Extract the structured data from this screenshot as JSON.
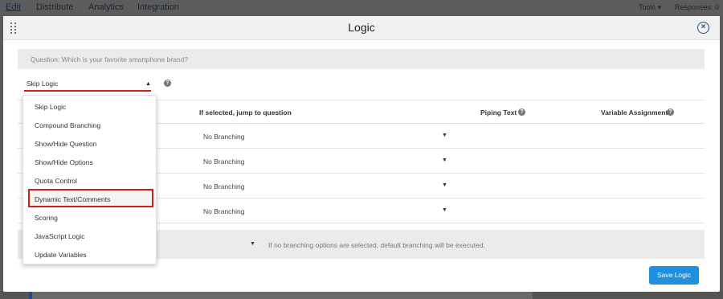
{
  "topnav": {
    "items": [
      "Edit",
      "Distribute",
      "Analytics",
      "Integration"
    ],
    "tools_label": "Tools ▾",
    "responses_label": "Responses: 0"
  },
  "modal": {
    "title": "Logic",
    "close_icon": "close-circle-icon",
    "question": "Question: Which is your favorite smartphone brand?",
    "logic_type": {
      "selected": "Skip Logic",
      "caret": "▲"
    },
    "help_glyph": "?",
    "table": {
      "headers": {
        "jump": "If selected, jump to question",
        "piping": "Piping Text",
        "variable": "Variable Assignment"
      },
      "rows": [
        {
          "branch": "No Branching",
          "caret": "▼"
        },
        {
          "branch": "No Branching",
          "caret": "▼"
        },
        {
          "branch": "No Branching",
          "caret": "▼"
        },
        {
          "branch": "No Branching",
          "caret": "▼"
        }
      ]
    },
    "footer": {
      "caret": "▼",
      "note": "If no branching options are selected, default branching will be executed."
    },
    "save_label": "Save Logic"
  },
  "dropdown": {
    "options": [
      "Skip Logic",
      "Compound Branching",
      "Show/Hide Question",
      "Show/Hide Options",
      "Quota Control",
      "Dynamic Text/Comments",
      "Scoring",
      "JavaScript Logic",
      "Update Variables"
    ],
    "highlighted": "Dynamic Text/Comments"
  },
  "colors": {
    "accent_blue": "#1f8fe0",
    "highlight_red": "#d21d1d",
    "close_blue": "#1f4d8a"
  }
}
